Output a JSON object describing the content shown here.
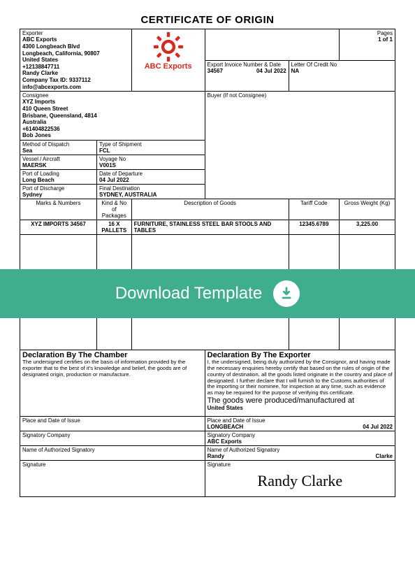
{
  "title": "CERTIFICATE OF ORIGIN",
  "pages_label": "Pages",
  "pages_value": "1 of 1",
  "exporter": {
    "label": "Exporter",
    "name": "ABC Exports",
    "addr1": "4300 Longbeach Blvd",
    "addr2": "Longbeach, California, 90807",
    "country": "United States",
    "phone": "+12138847711",
    "contact": "Randy Clarke",
    "tax": "Company Tax ID: 9337112",
    "email": "info@abcexports.com"
  },
  "brand": "ABC Exports",
  "invoice": {
    "label": "Export Invoice Number & Date",
    "no": "34567",
    "date": "04 Jul 2022"
  },
  "credit": {
    "label": "Letter Of Credit No",
    "value": "NA"
  },
  "consignee": {
    "label": "Consignee",
    "name": "XYZ Imports",
    "addr1": "410 Queen Street",
    "addr2": "Brisbane, Queensland, 4814",
    "country": "Australia",
    "phone": "+61404822536",
    "contact": "Bob Jones"
  },
  "buyer_label": "Buyer (If not Consignee)",
  "shipment": {
    "dispatch_label": "Method of Dispatch",
    "dispatch": "Sea",
    "type_label": "Type of Shipment",
    "type": "FCL",
    "vessel_label": "Vessel / Aircraft",
    "vessel": "MAERSK",
    "voyage_label": "Voyage No",
    "voyage": "V001S",
    "pol_label": "Port of Loading",
    "pol": "Long Beach",
    "dod_label": "Date of Departure",
    "dod": "04 Jul 2022",
    "pod_label": "Port of Discharge",
    "pod": "Sydney",
    "dest_label": "Final Destination",
    "dest": "SYDNEY, AUSTRALIA"
  },
  "goods_header": {
    "marks": "Marks & Numbers",
    "kind": "Kind & No of Packages",
    "desc": "Description of Goods",
    "tariff": "Tariff Code",
    "weight": "Gross Weight (Kg)"
  },
  "goods": {
    "marks": "XYZ IMPORTS 34567",
    "kind": "16 X PALLETS",
    "desc": "FURNITURE, STAINLESS STEEL BAR STOOLS AND TABLES",
    "tariff": "12345.6789",
    "weight": "3,225.00"
  },
  "chamber": {
    "title": "Declaration By The Chamber",
    "text": "The undersigned certifies on the basis of information provided by the exporter that to the best of it's knowledge and belief, the goods are of designated origin, production or manufacture."
  },
  "exp_decl": {
    "title": "Declaration By The Exporter",
    "text": "I, the undersigned, being duly authorized by the Consignor, and having made the necessary enquiries hereby certify that based on the rules of origin of the country of destination, all the goods listed originate in the country and place of designated. I further declare that I will furnish to the Customs authorities of the importing or their nominee, for inspection at any time, such as evidence as may be required for the purpose of verifying this certificate.",
    "manuf_label": "The goods were produced/manufactured at",
    "manuf": "United States"
  },
  "issue": {
    "place_label": "Place and Date of Issue",
    "place_r": "LONGBEACH",
    "date_r": "04 Jul 2022",
    "company_label": "Signatory Company",
    "company_r": "ABC Exports",
    "auth_label": "Name of Authorized Signatory",
    "first": "Randy",
    "last": "Clarke",
    "sig_label": "Signature",
    "sig_script": "Randy Clarke"
  },
  "overlay": "Download Template"
}
